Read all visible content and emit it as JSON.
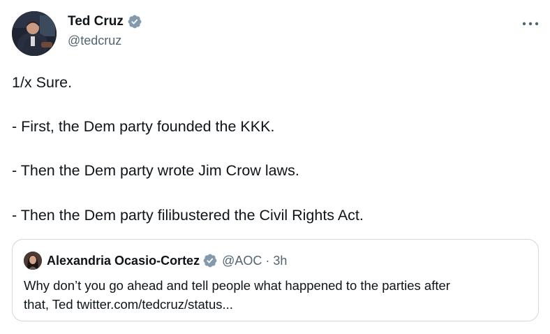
{
  "author": {
    "display_name": "Ted Cruz",
    "handle": "@tedcruz",
    "verified_icon": "verified-badge-icon"
  },
  "menu": {
    "icon": "more-options-icon"
  },
  "tweet": {
    "lines": [
      "1/x Sure.",
      "",
      "- First, the Dem party founded the KKK.",
      "",
      "- Then the Dem party wrote Jim Crow laws.",
      "",
      "- Then the Dem party filibustered the Civil Rights Act."
    ]
  },
  "quoted_tweet": {
    "display_name": "Alexandria Ocasio-Cortez",
    "handle": "@AOC",
    "separator": "·",
    "time": "3h",
    "text_lines": [
      "Why don’t you go ahead and tell people what happened to the parties after",
      "that, Ted twitter.com/tedcruz/status..."
    ]
  },
  "colors": {
    "text_primary": "#0f1419",
    "text_secondary": "#536471",
    "verified_blue": "#829aab",
    "border": "#cfd9de"
  }
}
